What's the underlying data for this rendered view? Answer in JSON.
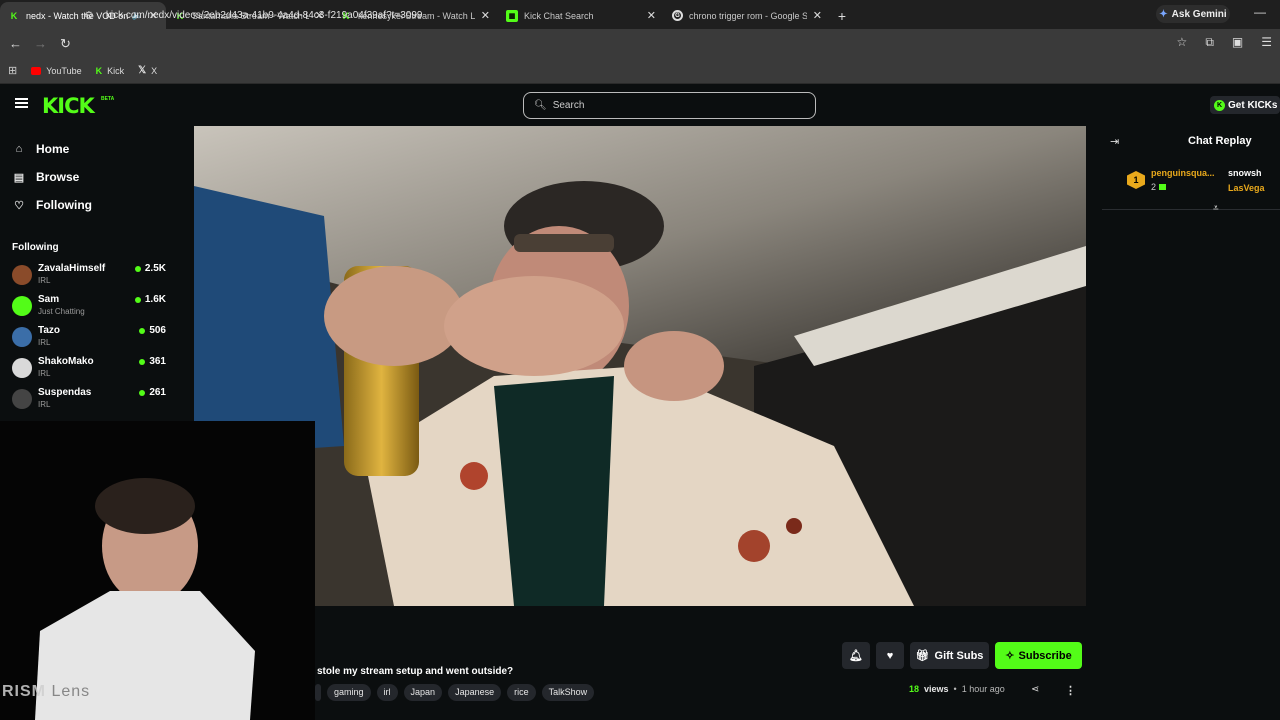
{
  "browser": {
    "tabs": [
      {
        "title": "nedx - Watch the VOD on K",
        "favicon": "kick",
        "active": true
      },
      {
        "title": "Santamaria Stream - Watch Live",
        "favicon": "kick",
        "active": false
      },
      {
        "title": "kennesykei Stream - Watch Live",
        "favicon": "kick",
        "active": false
      },
      {
        "title": "Kick Chat Search",
        "favicon": "sheet",
        "active": false
      },
      {
        "title": "chrono trigger rom - Google Se",
        "favicon": "google",
        "active": false
      }
    ],
    "gemini_label": "Ask Gemini",
    "url": "kick.com/nedx/videos/2eb2d43a-41b9-4a4d-84c3-f219a04f39af?t=3099",
    "bookmarks": [
      {
        "label": "YouTube",
        "icon": "youtube-icon"
      },
      {
        "label": "Kick",
        "icon": "kick-icon"
      },
      {
        "label": "X",
        "icon": "x-icon"
      }
    ]
  },
  "kick": {
    "logo": "KICK",
    "beta": "BETA",
    "search_placeholder": "Search",
    "get_kicks": "Get KICKs",
    "nav": [
      {
        "label": "Home",
        "icon": "home-icon"
      },
      {
        "label": "Browse",
        "icon": "browse-icon"
      },
      {
        "label": "Following",
        "icon": "heart-icon"
      }
    ],
    "following_heading": "Following",
    "following": [
      {
        "name": "ZavalaHimself",
        "category": "IRL",
        "viewers": "2.5K",
        "color": "#8a4b2a"
      },
      {
        "name": "Sam",
        "category": "Just Chatting",
        "viewers": "1.6K",
        "color": "#53fc18"
      },
      {
        "name": "Tazo",
        "category": "IRL",
        "viewers": "506",
        "color": "#3b6ea8"
      },
      {
        "name": "ShakoMako",
        "category": "IRL",
        "viewers": "361",
        "color": "#d9d9d9"
      },
      {
        "name": "Suspendas",
        "category": "IRL",
        "viewers": "261",
        "color": "#444444"
      }
    ]
  },
  "stream": {
    "title": "stole my stream setup and went outside?",
    "tags": [
      "gaming",
      "irl",
      "Japan",
      "Japanese",
      "rice",
      "TalkShow"
    ],
    "views_count": "18",
    "views_label": "views",
    "separator": "•",
    "age": "1 hour ago",
    "gift_subs": "Gift Subs",
    "subscribe": "Subscribe",
    "webcam_watermark": "RISM",
    "webcam_watermark_faded": "Lens"
  },
  "chat": {
    "title": "Chat Replay",
    "pinned": {
      "rank": "1",
      "name": "penguinsqua...",
      "count": "2",
      "second_name": "snowsh",
      "third_name": "LasVega"
    }
  },
  "colors": {
    "kick_green": "#53fc18",
    "background": "#0b0e0f",
    "gold": "#e9a91c"
  }
}
